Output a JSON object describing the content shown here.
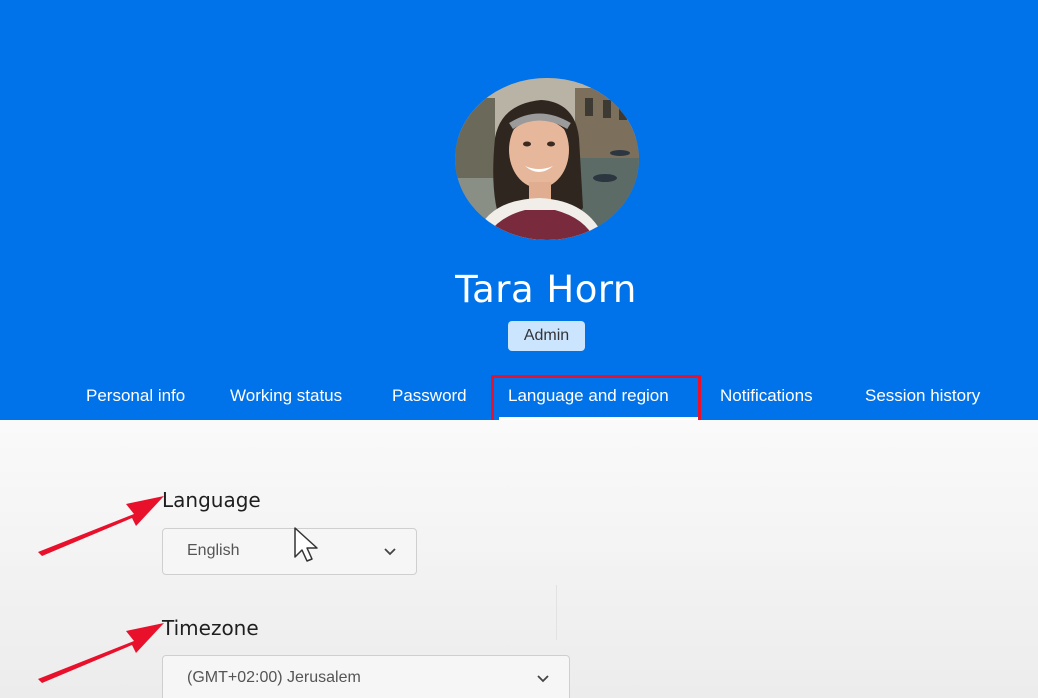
{
  "profile": {
    "name": "Tara Horn",
    "role": "Admin"
  },
  "tabs": [
    {
      "label": "Personal info"
    },
    {
      "label": "Working status"
    },
    {
      "label": "Password"
    },
    {
      "label": "Language and region",
      "active": true
    },
    {
      "label": "Notifications"
    },
    {
      "label": "Session history"
    }
  ],
  "settings": {
    "language": {
      "label": "Language",
      "value": "English"
    },
    "timezone": {
      "label": "Timezone",
      "value": "(GMT+02:00) Jerusalem"
    }
  },
  "colors": {
    "header": "#0073ea",
    "annotation": "#e8102b",
    "badge": "#cce5ff"
  },
  "icons": [
    "chevron-down-icon",
    "mouse-cursor-icon",
    "annotation-arrow-icon"
  ]
}
